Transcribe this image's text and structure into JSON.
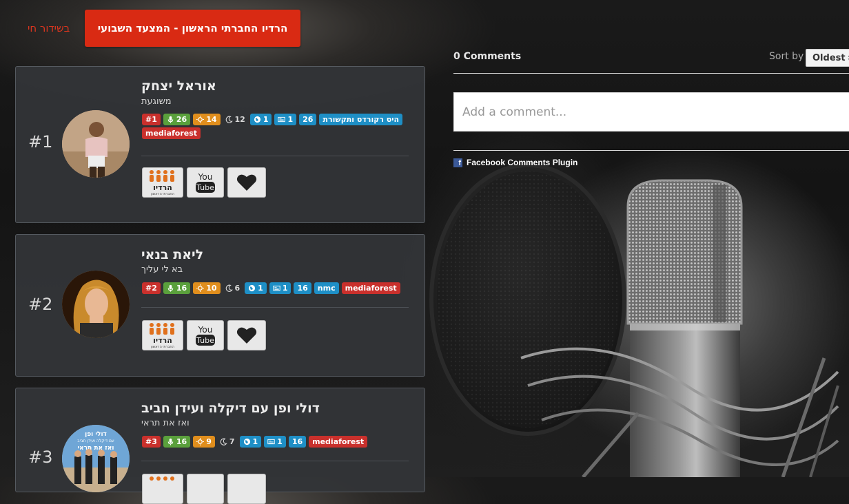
{
  "header": {
    "live_label": "בשידור חי",
    "main_button_label": "הרדיו החברתי הראשון - המצעד השבועי"
  },
  "chart_items": [
    {
      "rank": "#1",
      "title": "אוראל יצחק",
      "subtitle": "משוגעת",
      "badges": {
        "position": "#1",
        "mic": "26",
        "sun": "14",
        "moon": "12",
        "globe": "1",
        "news": "1",
        "count": "26",
        "source": "היס רקורדס ותקשורת",
        "extra": "mediaforest"
      }
    },
    {
      "rank": "#2",
      "title": "ליאת בנאי",
      "subtitle": "בא לי עליך",
      "badges": {
        "position": "#2",
        "mic": "16",
        "sun": "10",
        "moon": "6",
        "globe": "1",
        "news": "1",
        "count": "16",
        "source": "nmc",
        "extra": "mediaforest"
      }
    },
    {
      "rank": "#3",
      "title": "דולי ופן עם דיקלה ועידן חביב",
      "subtitle": "ואז את תראי",
      "badges": {
        "position": "#3",
        "mic": "16",
        "sun": "9",
        "moon": "7",
        "globe": "1",
        "news": "1",
        "count": "16",
        "extra": "mediaforest"
      }
    }
  ],
  "actions": {
    "radio_logo_text": "הרדיו",
    "radio_logo_sub": "החברתי הראשון",
    "youtube_top": "You",
    "youtube_bottom": "Tube"
  },
  "album_art": {
    "line1": "דולי ופן",
    "line2": "עם דיקלה ועידן חביב",
    "line3": "ואז את תראי"
  },
  "comments": {
    "count_label": "0 Comments",
    "sort_label": "Sort by",
    "sort_value": "Oldest",
    "input_placeholder": "Add a comment...",
    "plugin_label": "Facebook Comments Plugin",
    "fb_glyph": "f"
  },
  "colors": {
    "accent_red": "#d92a13",
    "badge_red": "#c9302c",
    "badge_green": "#5aa03c",
    "badge_orange": "#e08e1d",
    "badge_blue": "#1e8fc6",
    "facebook_blue": "#3b5998"
  },
  "icons": [
    "microphone-icon",
    "sun-icon",
    "moon-icon",
    "globe-icon",
    "news-icon",
    "heart-icon",
    "youtube-icon",
    "radio-logo-icon",
    "facebook-icon",
    "sort-arrows-icon"
  ]
}
